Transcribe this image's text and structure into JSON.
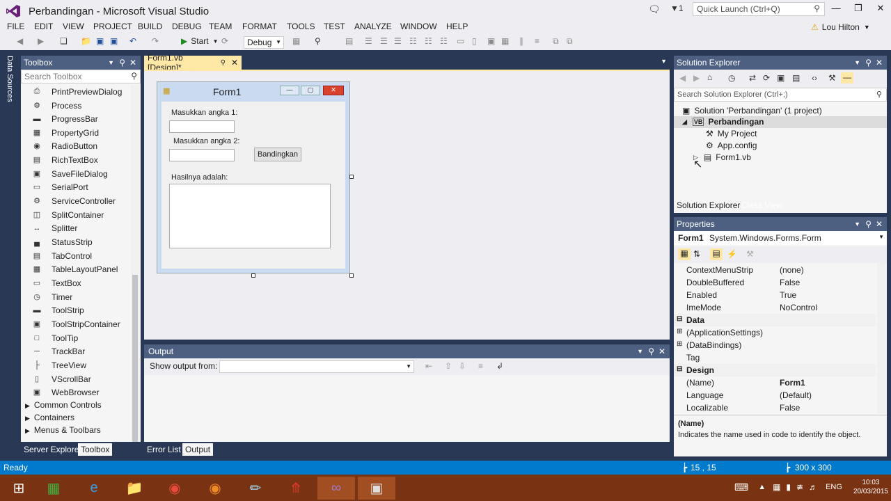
{
  "window": {
    "title": "Perbandingan - Microsoft Visual Studio",
    "notif_count": "1",
    "quick_launch_placeholder": "Quick Launch (Ctrl+Q)",
    "user": "Lou Hilton"
  },
  "menu": [
    "FILE",
    "EDIT",
    "VIEW",
    "PROJECT",
    "BUILD",
    "DEBUG",
    "TEAM",
    "FORMAT",
    "TOOLS",
    "TEST",
    "ANALYZE",
    "WINDOW",
    "HELP"
  ],
  "toolbar": {
    "start": "Start",
    "config": "Debug"
  },
  "left_strip": {
    "data_sources": "Data Sources"
  },
  "toolbox": {
    "title": "Toolbox",
    "search_placeholder": "Search Toolbox",
    "items": [
      "PrintPreviewDialog",
      "Process",
      "ProgressBar",
      "PropertyGrid",
      "RadioButton",
      "RichTextBox",
      "SaveFileDialog",
      "SerialPort",
      "ServiceController",
      "SplitContainer",
      "Splitter",
      "StatusStrip",
      "TabControl",
      "TableLayoutPanel",
      "TextBox",
      "Timer",
      "ToolStrip",
      "ToolStripContainer",
      "ToolTip",
      "TrackBar",
      "TreeView",
      "VScrollBar",
      "WebBrowser"
    ],
    "groups": [
      "Common Controls",
      "Containers",
      "Menus & Toolbars"
    ],
    "bottom_tabs": {
      "server_explorer": "Server Explorer",
      "toolbox": "Toolbox"
    }
  },
  "document": {
    "tab": "Form1.vb [Design]*",
    "form": {
      "title": "Form1",
      "label1": "Masukkan angka 1:",
      "label2": "Masukkan angka 2:",
      "button": "Bandingkan",
      "label3": "Hasilnya adalah:"
    }
  },
  "output": {
    "title": "Output",
    "show_from": "Show output from:",
    "bottom_tabs": {
      "error_list": "Error List",
      "output": "Output"
    }
  },
  "solution_explorer": {
    "title": "Solution Explorer",
    "search_placeholder": "Search Solution Explorer (Ctrl+;)",
    "solution": "Solution 'Perbandingan' (1 project)",
    "project": "Perbandingan",
    "nodes": [
      "My Project",
      "App.config",
      "Form1.vb"
    ],
    "tabs": {
      "solution_explorer": "Solution Explorer",
      "class_view": "Class View"
    }
  },
  "properties": {
    "title": "Properties",
    "object_name": "Form1",
    "object_type": "System.Windows.Forms.Form",
    "rows": [
      {
        "name": "ContextMenuStrip",
        "value": "(none)"
      },
      {
        "name": "DoubleBuffered",
        "value": "False"
      },
      {
        "name": "Enabled",
        "value": "True"
      },
      {
        "name": "ImeMode",
        "value": "NoControl"
      }
    ],
    "cat_data": "Data",
    "data_rows": [
      {
        "name": "(ApplicationSettings)",
        "value": ""
      },
      {
        "name": "(DataBindings)",
        "value": ""
      },
      {
        "name": "Tag",
        "value": ""
      }
    ],
    "cat_design": "Design",
    "design_rows": [
      {
        "name": "(Name)",
        "value": "Form1"
      },
      {
        "name": "Language",
        "value": "(Default)"
      },
      {
        "name": "Localizable",
        "value": "False"
      }
    ],
    "desc_title": "(Name)",
    "desc_text": "Indicates the name used in code to identify the object."
  },
  "status": {
    "text": "Ready",
    "position": "15 , 15",
    "size": "300 x 300"
  },
  "taskbar": {
    "lang": "ENG",
    "time": "10:03",
    "date": "20/03/2015"
  },
  "colors": {
    "accent": "#007acc",
    "header": "#4d6082",
    "background": "#293955",
    "tab_active": "#ffe8a6",
    "taskbar": "#7a3312"
  }
}
